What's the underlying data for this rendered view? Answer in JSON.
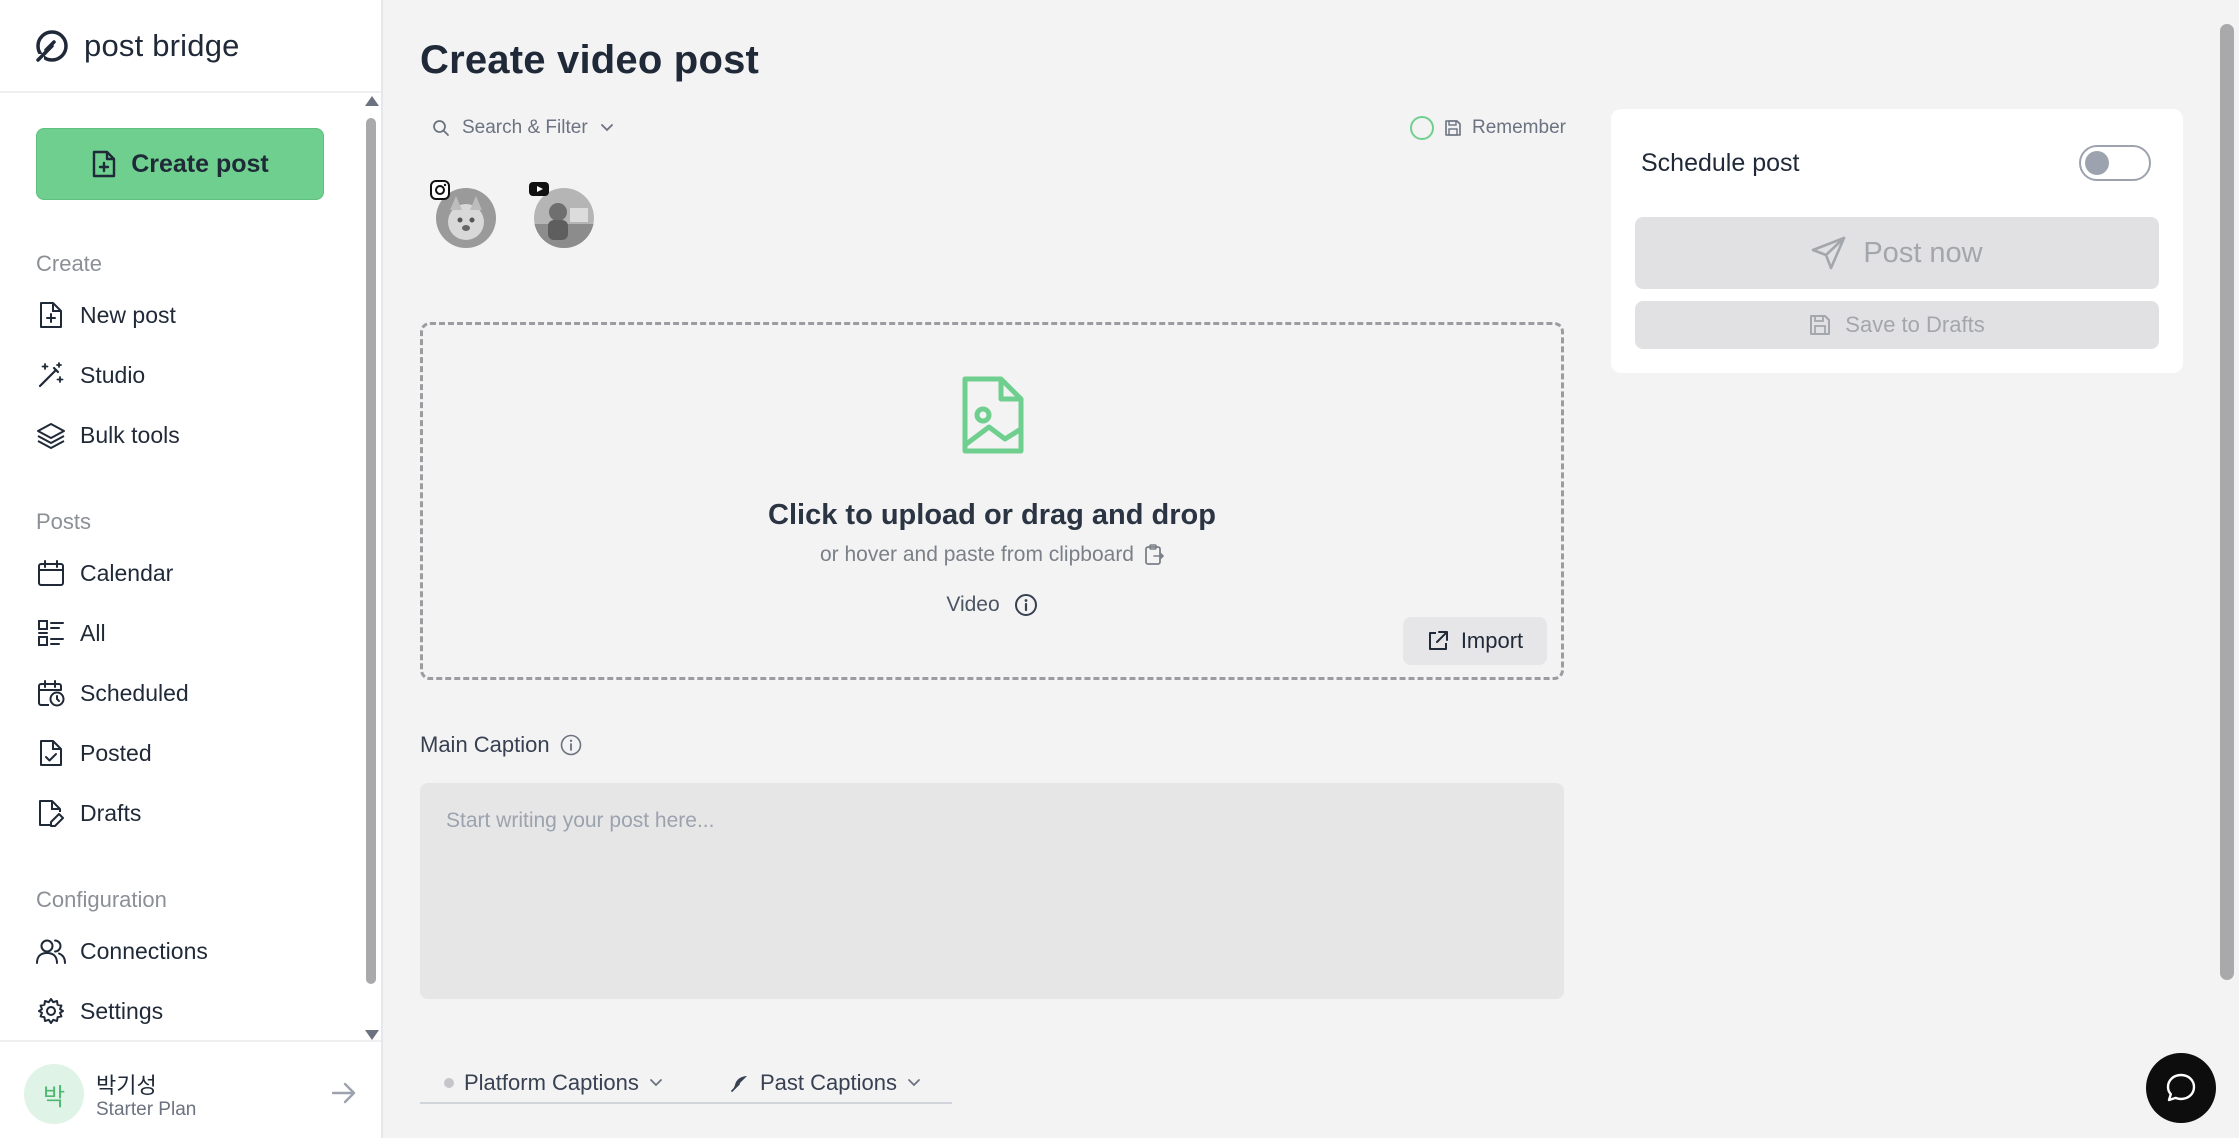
{
  "app": {
    "name": "post bridge"
  },
  "sidebar": {
    "create_button": "Create post",
    "sections": {
      "create": "Create",
      "posts": "Posts",
      "configuration": "Configuration"
    },
    "items": {
      "new_post": "New post",
      "studio": "Studio",
      "bulk_tools": "Bulk tools",
      "calendar": "Calendar",
      "all": "All",
      "scheduled": "Scheduled",
      "posted": "Posted",
      "drafts": "Drafts",
      "connections": "Connections",
      "settings": "Settings"
    },
    "user": {
      "initial": "박",
      "name": "박기성",
      "plan": "Starter Plan"
    }
  },
  "main": {
    "title": "Create video post",
    "search_filter": "Search & Filter",
    "remember": "Remember",
    "accounts": [
      {
        "platform": "instagram-icon"
      },
      {
        "platform": "youtube-icon"
      }
    ],
    "upload": {
      "title": "Click to upload or drag and drop",
      "subtitle": "or hover and paste from clipboard",
      "type": "Video",
      "import": "Import"
    },
    "caption": {
      "label": "Main Caption",
      "placeholder": "Start writing your post here..."
    },
    "tabs": {
      "platform_captions": "Platform Captions",
      "past_captions": "Past Captions"
    }
  },
  "panel": {
    "schedule_label": "Schedule post",
    "schedule_enabled": false,
    "post_now": "Post now",
    "save_drafts": "Save to Drafts"
  },
  "colors": {
    "accent": "#6fcf8e",
    "background": "#f3f3f4",
    "disabled": "#e1e1e3"
  }
}
